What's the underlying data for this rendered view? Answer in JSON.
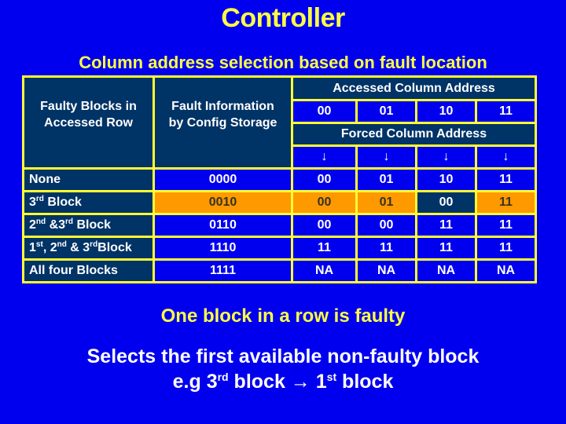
{
  "title": "Controller",
  "subtitle": "Column address selection based on fault location",
  "table": {
    "header": {
      "col1": "Faulty Blocks in Accessed Row",
      "col1_line1": "Faulty Blocks in",
      "col1_line2": "Accessed Row",
      "col2_line1": "Fault Information",
      "col2_line2": "by Config Storage",
      "accessed_label": "Accessed Column Address",
      "accessed_cols": [
        "00",
        "01",
        "10",
        "11"
      ],
      "forced_label": "Forced Column Address",
      "arrow_glyph": "↓"
    },
    "rows": [
      {
        "block": "None",
        "block_parts": [
          [
            "None",
            ""
          ]
        ],
        "fault_info": "0000",
        "forced": [
          "00",
          "01",
          "10",
          "11"
        ],
        "highlight": false
      },
      {
        "block": "3rd Block",
        "fault_info": "0010",
        "forced": [
          "00",
          "01",
          "00",
          "11"
        ],
        "highlight": true,
        "changed_index": 2
      },
      {
        "block": "2nd &3rd Block",
        "fault_info": "0110",
        "forced": [
          "00",
          "00",
          "11",
          "11"
        ],
        "highlight": false
      },
      {
        "block": "1st, 2nd & 3rd Block",
        "fault_info": "1110",
        "forced": [
          "11",
          "11",
          "11",
          "11"
        ],
        "highlight": false
      },
      {
        "block": "All four Blocks",
        "fault_info": "1111",
        "forced": [
          "NA",
          "NA",
          "NA",
          "NA"
        ],
        "highlight": false
      }
    ],
    "row_labels": {
      "r0": {
        "t1": "None"
      },
      "r1": {
        "n1": "3",
        "s1": "rd",
        "t1": " Block"
      },
      "r2": {
        "n1": "2",
        "s1": "nd",
        "t1": " &3",
        "s2": "rd",
        "t2": " Block"
      },
      "r3": {
        "n1": "1",
        "s1": "st",
        "t1": ", 2",
        "s2": "nd",
        "t2": " & 3",
        "s3": "rd",
        "t3": "Block"
      },
      "r4": {
        "t1": "All four Blocks"
      }
    }
  },
  "message": {
    "headline": "One block in a row is faulty",
    "line1": "Selects the first available non-faulty block",
    "line2_prefix": "e.g 3",
    "line2_sup1": "rd",
    "line2_mid": " block → 1",
    "line2_sup2": "st",
    "line2_suffix": " block"
  },
  "colors": {
    "background": "#0000ee",
    "title_yellow": "#ffff44",
    "grid_yellow": "#ffff33",
    "header_dark": "#003366",
    "highlight_orange": "#ff9900"
  }
}
